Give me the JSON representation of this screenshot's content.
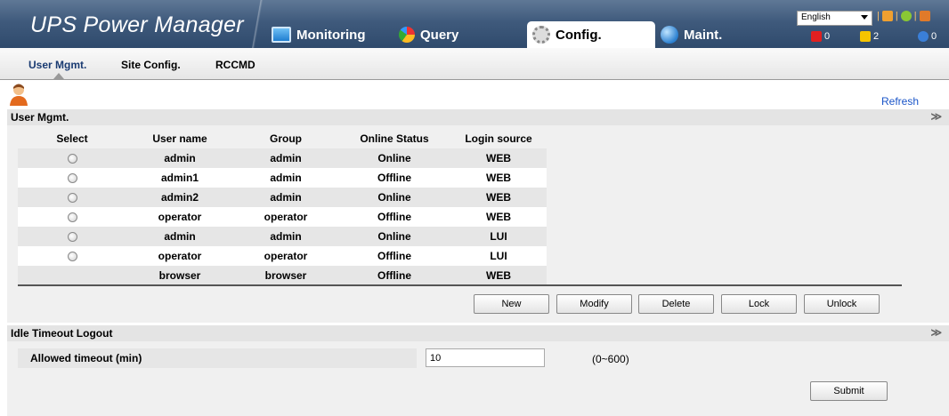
{
  "header": {
    "app_title": "UPS Power Manager",
    "tabs": [
      {
        "label": "Monitoring",
        "icon": "monitor-icon"
      },
      {
        "label": "Query",
        "icon": "pie-chart-icon"
      },
      {
        "label": "Config.",
        "icon": "gear-icon"
      },
      {
        "label": "Maint.",
        "icon": "globe-icon"
      }
    ],
    "active_tab": "Config.",
    "language": "English",
    "alarms": {
      "critical": "0",
      "warning": "2",
      "info": "0"
    }
  },
  "subnav": {
    "items": [
      "User Mgmt.",
      "Site Config.",
      "RCCMD"
    ],
    "active": "User Mgmt."
  },
  "toolbar": {
    "refresh_label": "Refresh"
  },
  "user_mgmt": {
    "section_title": "User Mgmt.",
    "columns": [
      "Select",
      "User name",
      "Group",
      "Online Status",
      "Login source"
    ],
    "rows": [
      {
        "user": "admin",
        "group": "admin",
        "status": "Online",
        "source": "WEB",
        "selectable": true
      },
      {
        "user": "admin1",
        "group": "admin",
        "status": "Offline",
        "source": "WEB",
        "selectable": true
      },
      {
        "user": "admin2",
        "group": "admin",
        "status": "Online",
        "source": "WEB",
        "selectable": true
      },
      {
        "user": "operator",
        "group": "operator",
        "status": "Offline",
        "source": "WEB",
        "selectable": true
      },
      {
        "user": "admin",
        "group": "admin",
        "status": "Online",
        "source": "LUI",
        "selectable": true
      },
      {
        "user": "operator",
        "group": "operator",
        "status": "Offline",
        "source": "LUI",
        "selectable": true
      },
      {
        "user": "browser",
        "group": "browser",
        "status": "Offline",
        "source": "WEB",
        "selectable": false
      }
    ],
    "buttons": {
      "new": "New",
      "modify": "Modify",
      "delete": "Delete",
      "lock": "Lock",
      "unlock": "Unlock"
    }
  },
  "idle_timeout": {
    "section_title": "Idle Timeout Logout",
    "field_label": "Allowed timeout (min)",
    "value": "10",
    "range": "(0~600)",
    "submit_label": "Submit"
  }
}
